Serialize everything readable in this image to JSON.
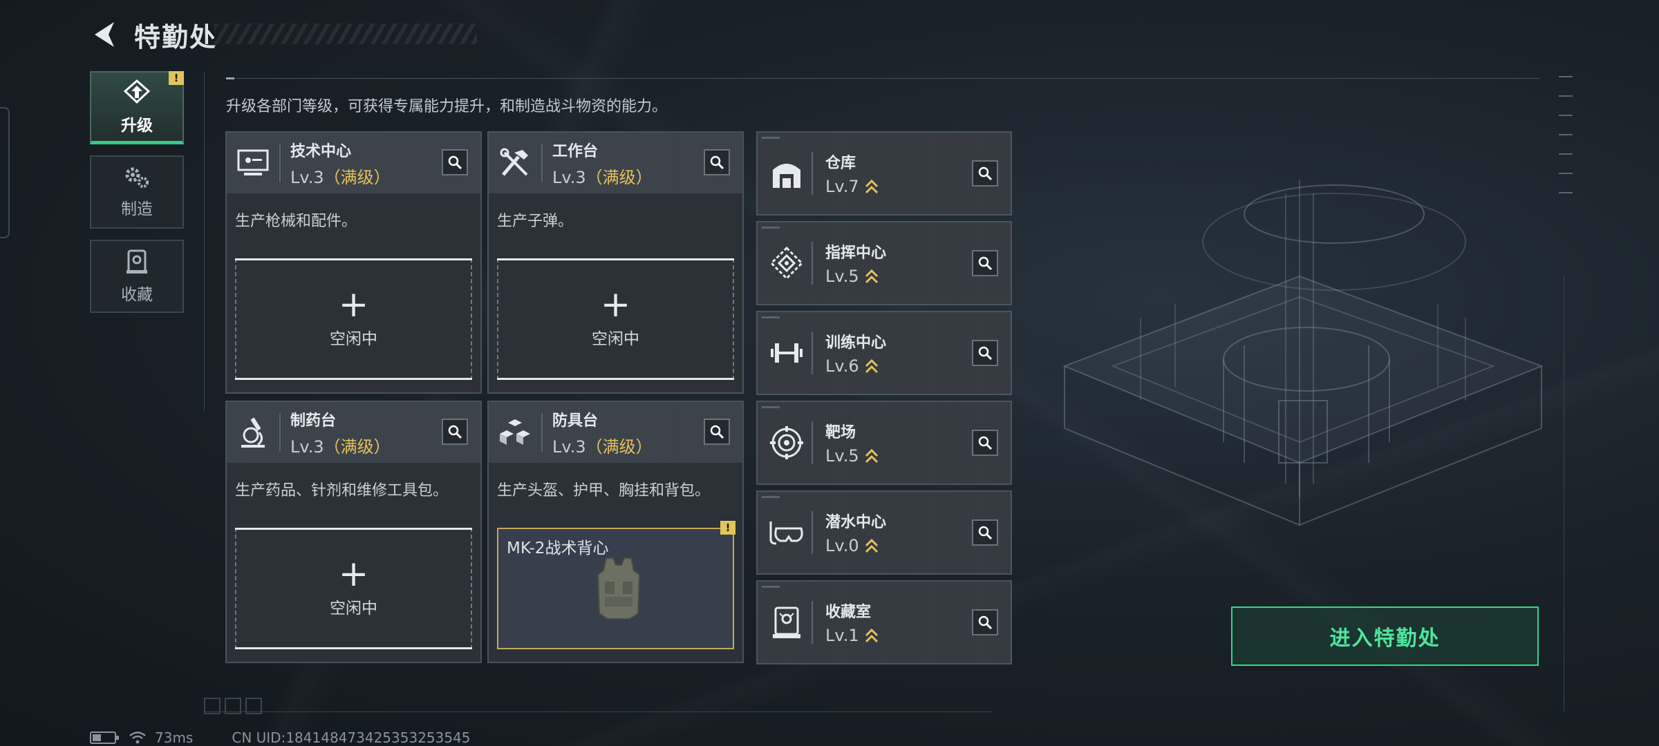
{
  "header": {
    "title": "特勤处"
  },
  "nav": {
    "items": [
      {
        "label": "升级",
        "active": true,
        "badge": "!"
      },
      {
        "label": "制造",
        "active": false
      },
      {
        "label": "收藏",
        "active": false
      }
    ]
  },
  "description": "升级各部门等级，可获得专属能力提升，和制造战斗物资的能力。",
  "stations": [
    {
      "name": "技术中心",
      "level": "Lv.3",
      "max": "（满级）",
      "desc": "生产枪械和配件。",
      "slot": {
        "plus": "+",
        "status": "空闲中"
      }
    },
    {
      "name": "工作台",
      "level": "Lv.3",
      "max": "（满级）",
      "desc": "生产子弹。",
      "slot": {
        "plus": "+",
        "status": "空闲中"
      }
    },
    {
      "name": "制药台",
      "level": "Lv.3",
      "max": "（满级）",
      "desc": "生产药品、针剂和维修工具包。",
      "slot": {
        "plus": "+",
        "status": "空闲中"
      }
    },
    {
      "name": "防具台",
      "level": "Lv.3",
      "max": "（满级）",
      "desc": "生产头盔、护甲、胸挂和背包。",
      "item": {
        "name": "MK-2战术背心",
        "badge": "!"
      }
    }
  ],
  "facilities": [
    {
      "name": "仓库",
      "level": "Lv.7",
      "icon": "warehouse-icon"
    },
    {
      "name": "指挥中心",
      "level": "Lv.5",
      "icon": "command-center-icon"
    },
    {
      "name": "训练中心",
      "level": "Lv.6",
      "icon": "dumbbell-icon"
    },
    {
      "name": "靶场",
      "level": "Lv.5",
      "icon": "target-icon"
    },
    {
      "name": "潜水中心",
      "level": "Lv.0",
      "icon": "diving-mask-icon"
    },
    {
      "name": "收藏室",
      "level": "Lv.1",
      "icon": "collection-room-icon"
    }
  ],
  "enter_button": "进入特勤处",
  "footer": {
    "ping": "73ms",
    "uid": "CN UID:18414847342535325354​5"
  },
  "colors": {
    "accent_green": "#3bd48e",
    "max_gold": "#e8c15c",
    "warn_yellow": "#e2c55a"
  }
}
